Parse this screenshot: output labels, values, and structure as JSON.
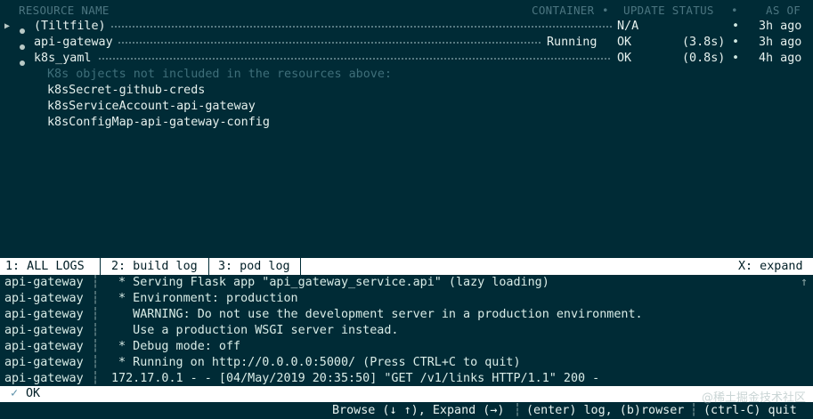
{
  "header": {
    "resource_name": "RESOURCE NAME",
    "container": "CONTAINER",
    "update_status": "UPDATE STATUS",
    "as_of": "AS OF",
    "bullet": "•"
  },
  "resources": [
    {
      "name": "(Tiltfile)",
      "container": "",
      "status": "N/A",
      "duration": "",
      "as_of": "3h ago",
      "selected": true
    },
    {
      "name": "api-gateway",
      "container": "Running",
      "status": "OK",
      "duration": "(3.8s)",
      "as_of": "3h ago",
      "selected": false
    },
    {
      "name": "k8s_yaml",
      "container": "",
      "status": "OK",
      "duration": "(0.8s)",
      "as_of": "4h ago",
      "selected": false
    }
  ],
  "k8s_objects": {
    "note": "K8s objects not included in the resources above:",
    "items": [
      "k8sSecret-github-creds",
      "k8sServiceAccount-api-gateway",
      "k8sConfigMap-api-gateway-config"
    ]
  },
  "tabs": {
    "all_logs": "1: ALL LOGS",
    "build_log": "2: build log",
    "pod_log": "3: pod log",
    "expand": "X: expand"
  },
  "logs": [
    {
      "source": "api-gateway",
      "text": " * Serving Flask app \"api_gateway_service.api\" (lazy loading)"
    },
    {
      "source": "api-gateway",
      "text": " * Environment: production"
    },
    {
      "source": "api-gateway",
      "text": "   WARNING: Do not use the development server in a production environment."
    },
    {
      "source": "api-gateway",
      "text": "   Use a production WSGI server instead."
    },
    {
      "source": "api-gateway",
      "text": " * Debug mode: off"
    },
    {
      "source": "api-gateway",
      "text": " * Running on http://0.0.0.0:5000/ (Press CTRL+C to quit)"
    },
    {
      "source": "api-gateway",
      "text": "172.17.0.1 - - [04/May/2019 20:35:50] \"GET /v1/links HTTP/1.1\" 200 -"
    }
  ],
  "log_separator": "┆",
  "scroll_up_glyph": "↑",
  "status": {
    "check": "✓",
    "text": "OK"
  },
  "footer": {
    "browse": "Browse (↓ ↑), Expand (→)",
    "log": "(enter) log, (b)rowser",
    "quit": "(ctrl-C) quit",
    "sep": "┆"
  },
  "watermark": "@稀土掘金技术社区"
}
